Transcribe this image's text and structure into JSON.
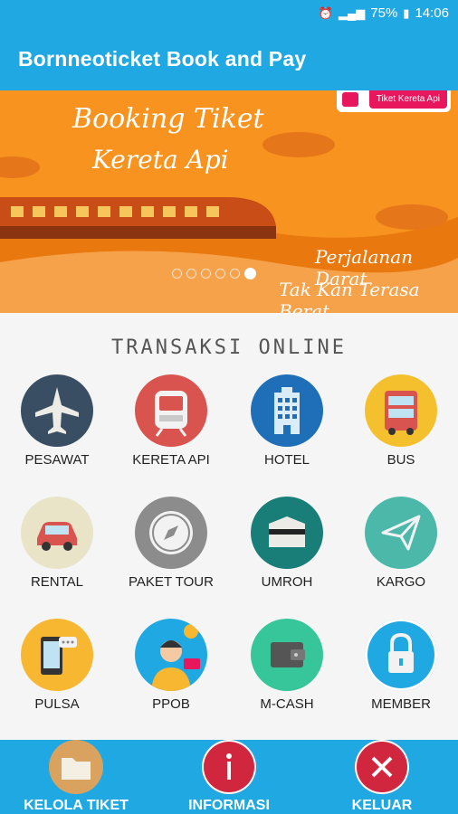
{
  "status_bar": {
    "battery": "75%",
    "time": "14:06"
  },
  "app_bar": {
    "title": "Bornneoticket Book and Pay"
  },
  "banner": {
    "title_line1": "Booking Tiket",
    "title_line2": "Kereta Api",
    "badge": "Tiket Kereta Api",
    "tagline_line1": "Perjalanan Darat",
    "tagline_line2": "Tak Kan Terasa Berat"
  },
  "section": {
    "title": "TRANSAKSI ONLINE"
  },
  "services": [
    {
      "label": "PESAWAT",
      "icon": "airplane-icon",
      "color": "#3a4e63"
    },
    {
      "label": "KERETA API",
      "icon": "train-icon",
      "color": "#d9534f"
    },
    {
      "label": "HOTEL",
      "icon": "hotel-building-icon",
      "color": "#1e6fb8"
    },
    {
      "label": "BUS",
      "icon": "bus-icon",
      "color": "#f5c02e"
    },
    {
      "label": "RENTAL",
      "icon": "car-icon",
      "color": "#e9e3c8"
    },
    {
      "label": "PAKET TOUR",
      "icon": "compass-icon",
      "color": "#8c8c8c"
    },
    {
      "label": "UMROH",
      "icon": "kaaba-icon",
      "color": "#197d78"
    },
    {
      "label": "KARGO",
      "icon": "paper-plane-icon",
      "color": "#4cb8a9"
    },
    {
      "label": "PULSA",
      "icon": "phone-chat-icon",
      "color": "#f7b731"
    },
    {
      "label": "PPOB",
      "icon": "customer-service-icon",
      "color": "#1fa8e1"
    },
    {
      "label": "M-CASH",
      "icon": "wallet-icon",
      "color": "#37c59a"
    },
    {
      "label": "MEMBER",
      "icon": "lock-icon",
      "color": "#1fa8e1"
    }
  ],
  "bottom_nav": [
    {
      "label": "KELOLA TIKET",
      "icon": "folder-icon",
      "color": "#d9a25f"
    },
    {
      "label": "INFORMASI",
      "icon": "info-icon",
      "color": "#d0273f"
    },
    {
      "label": "KELUAR",
      "icon": "close-icon",
      "color": "#d0273f"
    }
  ]
}
